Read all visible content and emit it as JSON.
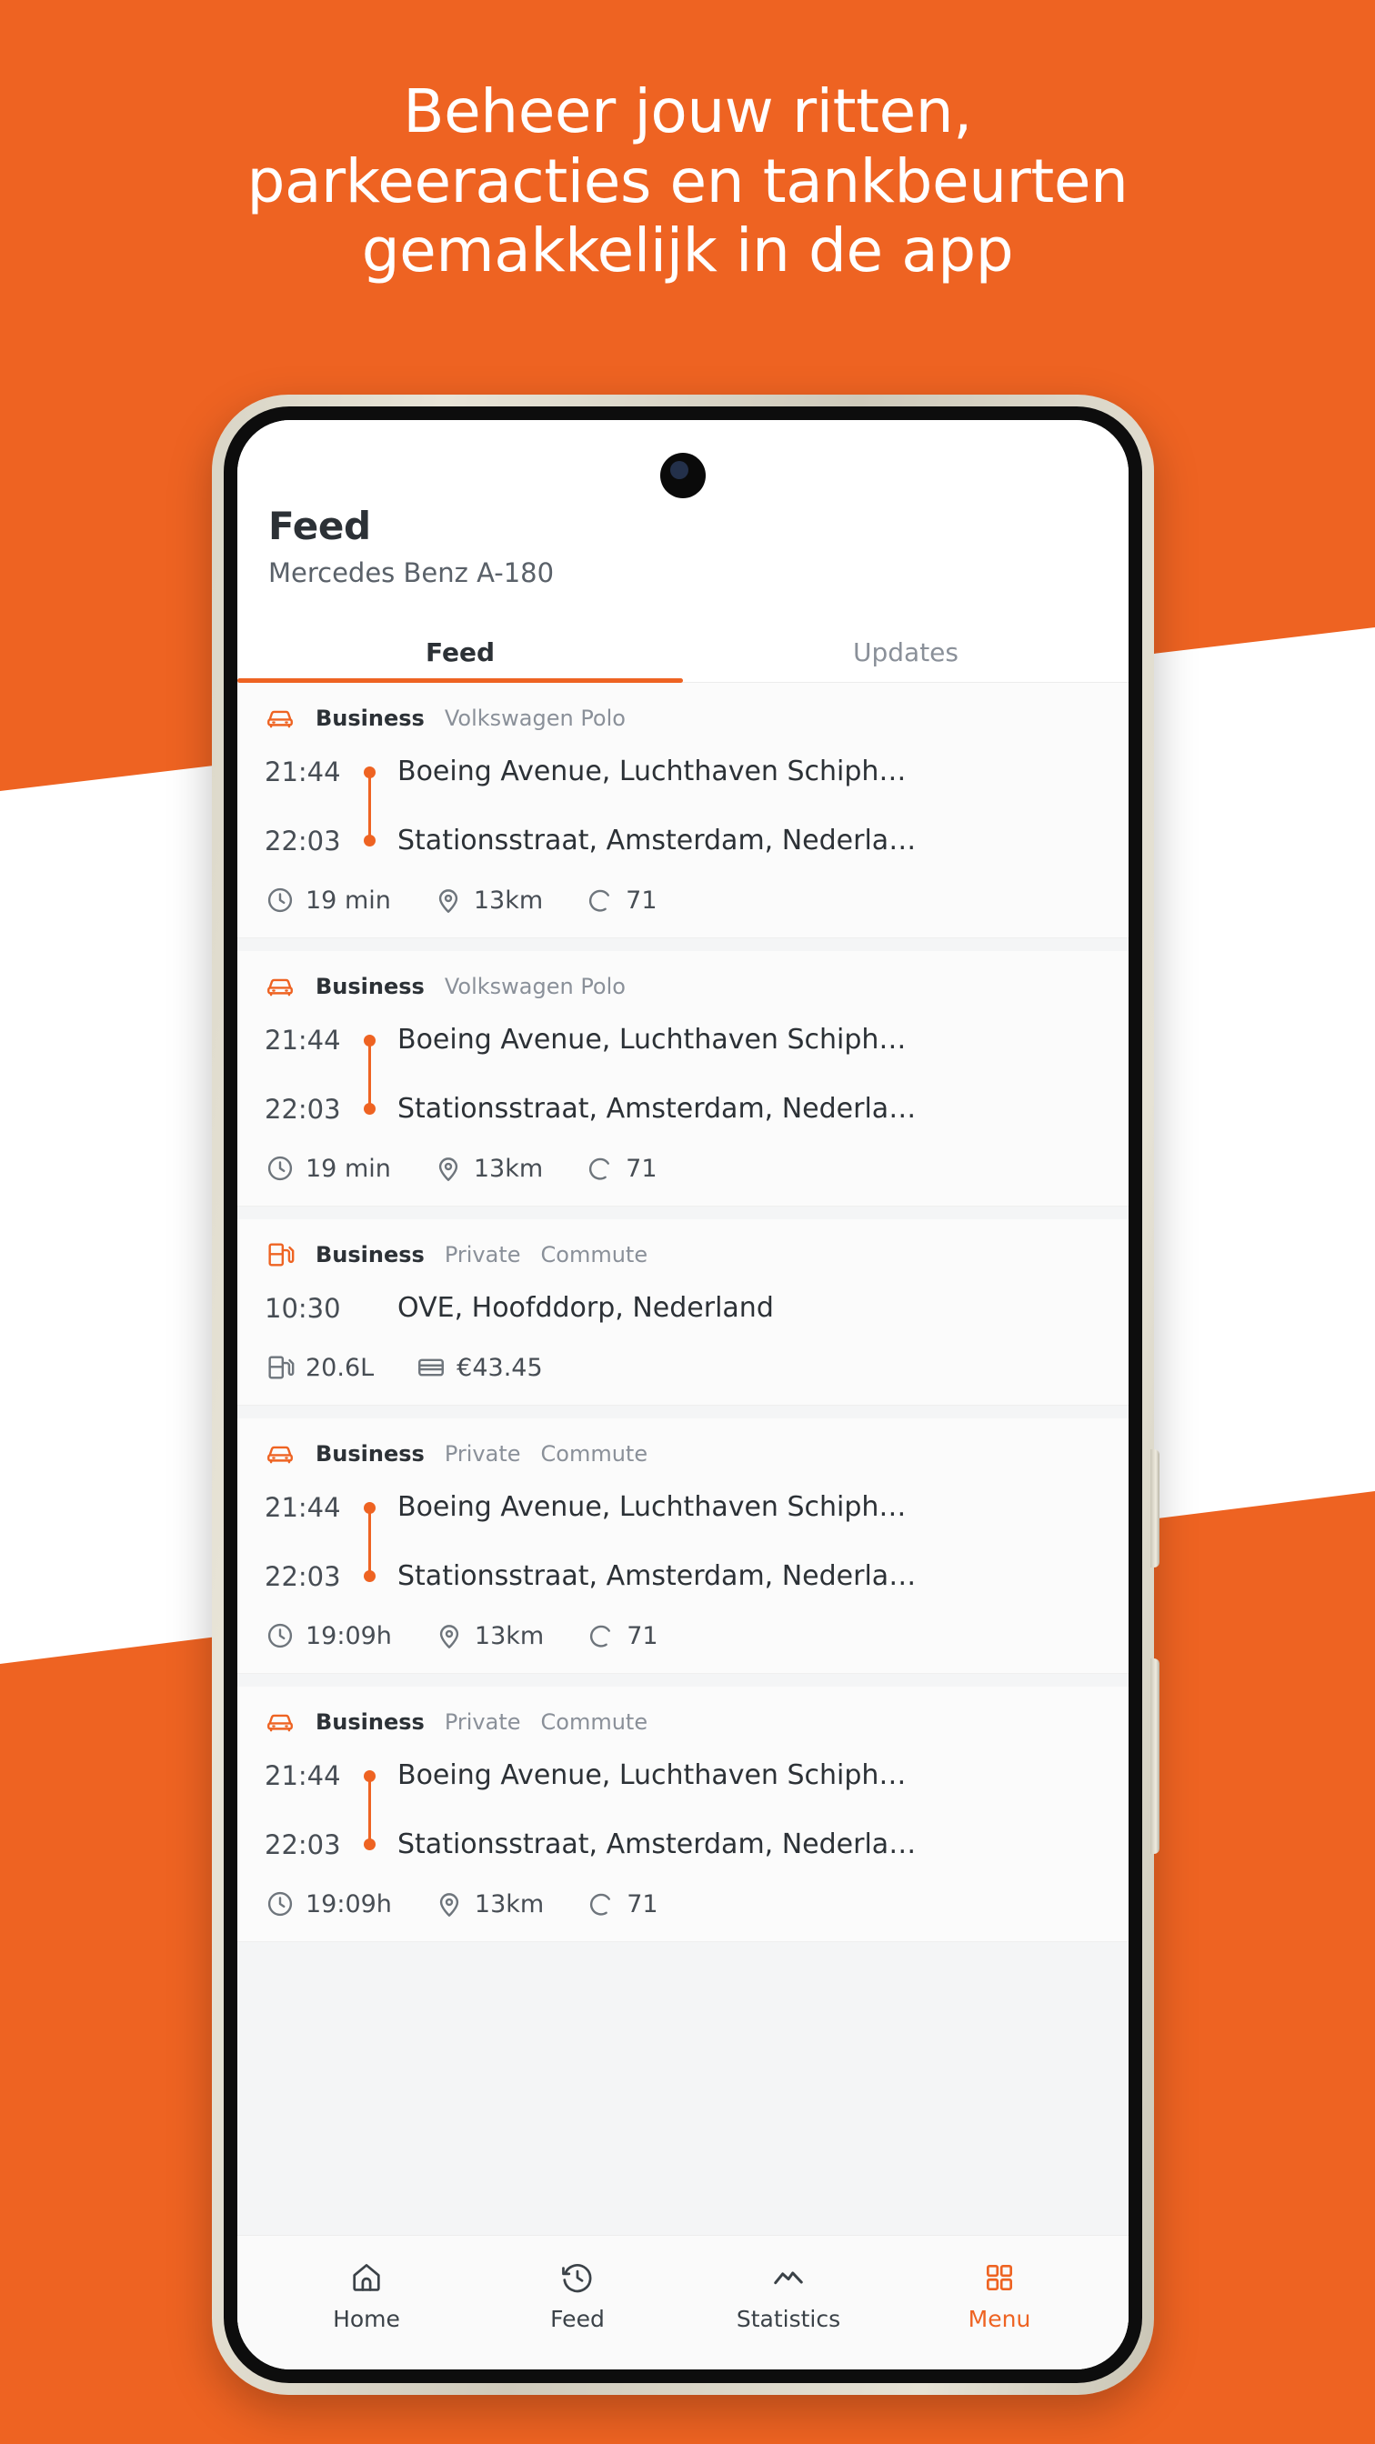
{
  "theme": {
    "accent": "#EE6322",
    "text_dark": "#2C3136",
    "text_muted": "#8A9099"
  },
  "headline": {
    "line1": "Beheer jouw ritten,",
    "line2": "parkeeracties en tankbeurten",
    "line3": "gemakkelijk in de app"
  },
  "app": {
    "title": "Feed",
    "subtitle": "Mercedes Benz A-180",
    "tabs": [
      {
        "label": "Feed",
        "active": true
      },
      {
        "label": "Updates",
        "active": false
      }
    ]
  },
  "feed": {
    "cards": [
      {
        "type": "trip",
        "icon": "car-icon",
        "tags": [
          "Business",
          "Volkswagen Polo"
        ],
        "start_time": "21:44",
        "end_time": "22:03",
        "start_address": "Boeing Avenue, Luchthaven Schiph…",
        "end_address": "Stationsstraat, Amsterdam, Nederla…",
        "stats": [
          {
            "icon": "clock-icon",
            "value": "19 min"
          },
          {
            "icon": "pin-icon",
            "value": "13km"
          },
          {
            "icon": "moon-icon",
            "value": "71"
          }
        ]
      },
      {
        "type": "trip",
        "icon": "car-icon",
        "tags": [
          "Business",
          "Volkswagen Polo"
        ],
        "start_time": "21:44",
        "end_time": "22:03",
        "start_address": "Boeing Avenue, Luchthaven Schiph…",
        "end_address": "Stationsstraat, Amsterdam, Nederla…",
        "stats": [
          {
            "icon": "clock-icon",
            "value": "19 min"
          },
          {
            "icon": "pin-icon",
            "value": "13km"
          },
          {
            "icon": "moon-icon",
            "value": "71"
          }
        ]
      },
      {
        "type": "fuel",
        "icon": "fuel-icon",
        "tags": [
          "Business",
          "Private",
          "Commute"
        ],
        "time": "10:30",
        "address": "OVE, Hoofddorp, Nederland",
        "stats": [
          {
            "icon": "fuel-icon",
            "value": "20.6L"
          },
          {
            "icon": "card-icon",
            "value": "€43.45"
          }
        ]
      },
      {
        "type": "trip",
        "icon": "car-icon",
        "tags": [
          "Business",
          "Private",
          "Commute"
        ],
        "start_time": "21:44",
        "end_time": "22:03",
        "start_address": "Boeing Avenue, Luchthaven Schiph…",
        "end_address": "Stationsstraat, Amsterdam, Nederla…",
        "stats": [
          {
            "icon": "clock-icon",
            "value": "19:09h"
          },
          {
            "icon": "pin-icon",
            "value": "13km"
          },
          {
            "icon": "moon-icon",
            "value": "71"
          }
        ]
      },
      {
        "type": "trip",
        "icon": "car-icon",
        "tags": [
          "Business",
          "Private",
          "Commute"
        ],
        "start_time": "21:44",
        "end_time": "22:03",
        "start_address": "Boeing Avenue, Luchthaven Schiph…",
        "end_address": "Stationsstraat, Amsterdam, Nederla…",
        "stats": [
          {
            "icon": "clock-icon",
            "value": "19:09h"
          },
          {
            "icon": "pin-icon",
            "value": "13km"
          },
          {
            "icon": "moon-icon",
            "value": "71"
          }
        ]
      }
    ]
  },
  "bottom_nav": {
    "items": [
      {
        "label": "Home",
        "icon": "home-icon",
        "active": false
      },
      {
        "label": "Feed",
        "icon": "history-icon",
        "active": false
      },
      {
        "label": "Statistics",
        "icon": "chart-line-icon",
        "active": false
      },
      {
        "label": "Menu",
        "icon": "grid-icon",
        "active": true
      }
    ]
  }
}
